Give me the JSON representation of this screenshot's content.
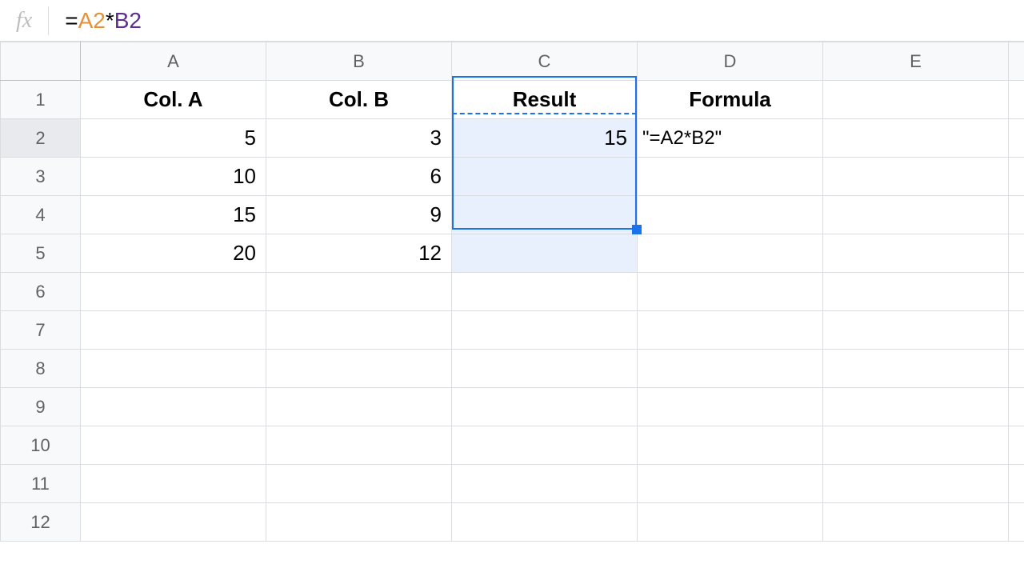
{
  "formulaBar": {
    "fx": "fx",
    "eq": "=",
    "refA": "A2",
    "op": "*",
    "refB": "B2"
  },
  "columns": [
    "A",
    "B",
    "C",
    "D",
    "E"
  ],
  "rowNumbers": [
    "1",
    "2",
    "3",
    "4",
    "5",
    "6",
    "7",
    "8",
    "9",
    "10",
    "11",
    "12"
  ],
  "headers": {
    "a": "Col. A",
    "b": "Col. B",
    "c": "Result",
    "d": "Formula"
  },
  "data": {
    "r2": {
      "a": "5",
      "b": "3",
      "c": "15",
      "d": "\"=A2*B2\""
    },
    "r3": {
      "a": "10",
      "b": "6"
    },
    "r4": {
      "a": "15",
      "b": "9"
    },
    "r5": {
      "a": "20",
      "b": "12"
    }
  },
  "selection": {
    "copySourceCell": "C2",
    "selectedRange": "C2:C5"
  },
  "colors": {
    "accent": "#1a73e8",
    "refOrange": "#e69138",
    "refPurple": "#5b2e8f",
    "headerBg": "#f8f9fa",
    "selectionFill": "#e8f0fe"
  }
}
